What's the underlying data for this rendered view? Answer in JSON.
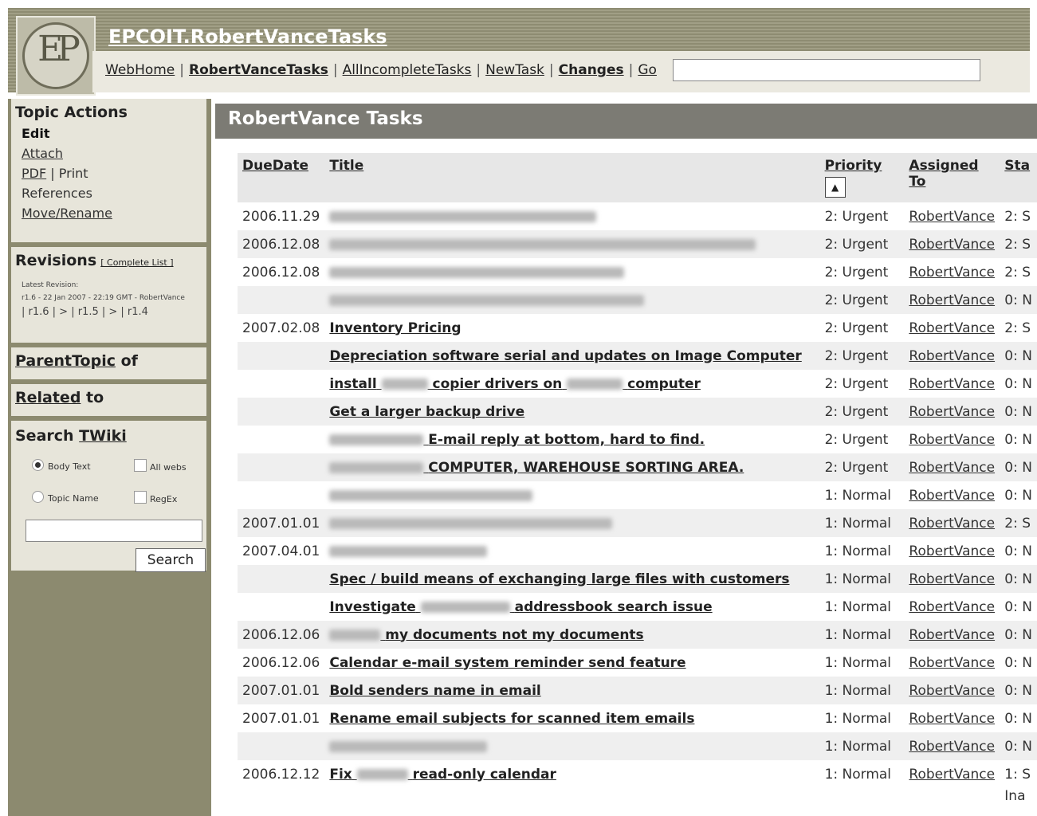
{
  "header": {
    "site_title": "EPCOIT.RobertVanceTasks",
    "nav": {
      "webhome": "WebHome",
      "robertvancetasks": "RobertVanceTasks",
      "allincomplete": "AllIncompleteTasks",
      "newtask": "NewTask",
      "changes": "Changes",
      "go": "Go",
      "separator": "|"
    },
    "go_value": ""
  },
  "sidebar": {
    "topic_actions": {
      "heading": "Topic Actions",
      "edit": "Edit",
      "attach": "Attach",
      "pdf": "PDF",
      "print": "Print",
      "references": "References",
      "move": "Move/Rename",
      "pipe": "|"
    },
    "revisions": {
      "heading": "Revisions",
      "complete_list": "[ Complete List ]",
      "latest_label": "Latest Revision:",
      "latest_value": "r1.6 - 22 Jan 2007 - 22:19 GMT - RobertVance",
      "history": "| r1.6 | > | r1.5 | > | r1.4"
    },
    "parent": {
      "link": "ParentTopic",
      "suffix": " of"
    },
    "related": {
      "link": "Related",
      "suffix": " to"
    },
    "search": {
      "heading_prefix": "Search ",
      "heading_link": "TWiki",
      "body_text": "Body Text",
      "all_webs": "All webs",
      "topic_name": "Topic Name",
      "regex": "RegEx",
      "button": "Search",
      "value": ""
    }
  },
  "main": {
    "title": "RobertVance Tasks",
    "columns": {
      "duedate": "DueDate",
      "title": "Title",
      "priority": "Priority",
      "assigned": "Assigned To",
      "status": "Sta"
    },
    "sort_icon": "▲",
    "rows": [
      {
        "due": "2006.11.29",
        "pre": "",
        "t": "",
        "post": "",
        "blur": [
          335
        ],
        "pri": "2: Urgent",
        "asg": "RobertVance",
        "st": "2: S"
      },
      {
        "due": "2006.12.08",
        "pre": "",
        "t": "",
        "post": "",
        "blur": [
          535
        ],
        "pri": "2: Urgent",
        "asg": "RobertVance",
        "st": "2: S"
      },
      {
        "due": "2006.12.08",
        "pre": "",
        "t": "",
        "post": "",
        "blur": [
          370
        ],
        "pri": "2: Urgent",
        "asg": "RobertVance",
        "st": "2: S"
      },
      {
        "due": "",
        "pre": "",
        "t": "",
        "post": "",
        "blur": [
          395
        ],
        "pri": "2: Urgent",
        "asg": "RobertVance",
        "st": "0: N"
      },
      {
        "due": "2007.02.08",
        "pre": "",
        "t": "Inventory Pricing",
        "post": "",
        "blur": [],
        "pri": "2: Urgent",
        "asg": "RobertVance",
        "st": "2: S"
      },
      {
        "due": "",
        "pre": "",
        "t": "Depreciation software serial and updates on Image Computer",
        "post": "",
        "blur": [],
        "pri": "2: Urgent",
        "asg": "RobertVance",
        "st": "0: N"
      },
      {
        "due": "",
        "pre": "install",
        "t": "copier drivers on",
        "post": "computer",
        "blur": [
          58,
          70
        ],
        "pri": "2: Urgent",
        "asg": "RobertVance",
        "st": "0: N"
      },
      {
        "due": "",
        "pre": "",
        "t": "Get a larger backup drive",
        "post": "",
        "blur": [],
        "pri": "2: Urgent",
        "asg": "RobertVance",
        "st": "0: N"
      },
      {
        "due": "",
        "pre": "",
        "t": "E-mail reply at bottom, hard to find.",
        "post": "",
        "blur": [
          118
        ],
        "pri": "2: Urgent",
        "asg": "RobertVance",
        "st": "0: N"
      },
      {
        "due": "",
        "pre": "",
        "t": "COMPUTER, WAREHOUSE SORTING AREA.",
        "post": "",
        "blur": [
          118
        ],
        "pri": "2: Urgent",
        "asg": "RobertVance",
        "st": "0: N"
      },
      {
        "due": "",
        "pre": "",
        "t": "",
        "post": "",
        "blur": [
          255
        ],
        "pri": "1: Normal",
        "asg": "RobertVance",
        "st": "0: N"
      },
      {
        "due": "2007.01.01",
        "pre": "",
        "t": "",
        "post": "",
        "blur": [
          355
        ],
        "pri": "1: Normal",
        "asg": "RobertVance",
        "st": "2: S"
      },
      {
        "due": "2007.04.01",
        "pre": "",
        "t": "",
        "post": "",
        "blur": [
          198
        ],
        "pri": "1: Normal",
        "asg": "RobertVance",
        "st": "0: N"
      },
      {
        "due": "",
        "pre": "",
        "t": "Spec / build means of exchanging large files with customers",
        "post": "",
        "blur": [],
        "pri": "1: Normal",
        "asg": "RobertVance",
        "st": "0: N"
      },
      {
        "due": "",
        "pre": "Investigate",
        "t": "addressbook search issue",
        "post": "",
        "blur": [
          112
        ],
        "pri": "1: Normal",
        "asg": "RobertVance",
        "st": "0: N"
      },
      {
        "due": "2006.12.06",
        "pre": "",
        "t": "my documents not my documents",
        "post": "",
        "blur": [
          64
        ],
        "pri": "1: Normal",
        "asg": "RobertVance",
        "st": "0: N"
      },
      {
        "due": "2006.12.06",
        "pre": "",
        "t": "Calendar e-mail system reminder send feature",
        "post": "",
        "blur": [],
        "pri": "1: Normal",
        "asg": "RobertVance",
        "st": "0: N"
      },
      {
        "due": "2007.01.01",
        "pre": "",
        "t": "Bold senders name in email",
        "post": "",
        "blur": [],
        "pri": "1: Normal",
        "asg": "RobertVance",
        "st": "0: N"
      },
      {
        "due": "2007.01.01",
        "pre": "",
        "t": "Rename email subjects for scanned item emails",
        "post": "",
        "blur": [],
        "pri": "1: Normal",
        "asg": "RobertVance",
        "st": "0: N"
      },
      {
        "due": "",
        "pre": "",
        "t": "",
        "post": "",
        "blur": [
          198
        ],
        "pri": "1: Normal",
        "asg": "RobertVance",
        "st": "0: N"
      },
      {
        "due": "2006.12.12",
        "pre": "Fix",
        "t": "read-only calendar",
        "post": "",
        "blur": [
          64
        ],
        "pri": "1: Normal",
        "asg": "RobertVance",
        "st": "1: S"
      }
    ],
    "last_row_extra": "Ina"
  }
}
